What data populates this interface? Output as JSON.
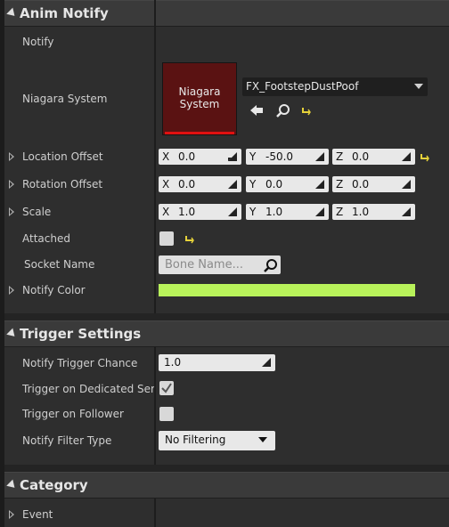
{
  "sections": {
    "anim_notify": {
      "title": "Anim Notify"
    },
    "trigger_settings": {
      "title": "Trigger Settings"
    },
    "category": {
      "title": "Category"
    }
  },
  "anim_notify": {
    "notify_label": "Notify",
    "niagara_system_label": "Niagara System",
    "niagara_thumb_text_line1": "Niagara",
    "niagara_thumb_text_line2": "System",
    "niagara_asset": "FX_FootstepDustPoof",
    "location_offset": {
      "label": "Location Offset",
      "x": "0.0",
      "y": "-50.0",
      "z": "0.0"
    },
    "rotation_offset": {
      "label": "Rotation Offset",
      "x": "0.0",
      "y": "0.0",
      "z": "0.0"
    },
    "scale": {
      "label": "Scale",
      "x": "1.0",
      "y": "1.0",
      "z": "1.0"
    },
    "attached_label": "Attached",
    "attached_checked": false,
    "socket_name_label": "Socket Name",
    "socket_name_placeholder": "Bone Name...",
    "notify_color_label": "Notify Color",
    "notify_color": "#b8f25a"
  },
  "trigger_settings": {
    "chance_label": "Notify Trigger Chance",
    "chance_value": "1.0",
    "dedicated_server_label": "Trigger on Dedicated Serv",
    "dedicated_server_checked": true,
    "follower_label": "Trigger on Follower",
    "follower_checked": false,
    "filter_type_label": "Notify Filter Type",
    "filter_type_value": "No Filtering"
  },
  "category": {
    "event_label": "Event"
  },
  "axes": {
    "x": "X",
    "y": "Y",
    "z": "Z"
  },
  "colors": {
    "accent_reset": "#e6d23a",
    "thumb_bar": "#e01010",
    "thumb_bg": "#5a1212"
  }
}
